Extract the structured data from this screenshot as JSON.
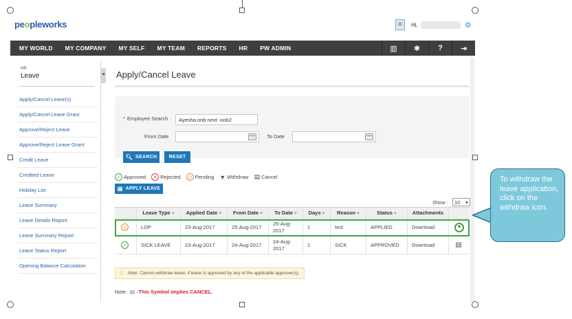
{
  "header": {
    "logo_primary": "pe",
    "logo_accent": "o",
    "logo_rest": "pleworks",
    "greeting": "Hi,"
  },
  "nav": {
    "items": [
      "MY WORLD",
      "MY COMPANY",
      "MY SELF",
      "MY TEAM",
      "REPORTS",
      "HR",
      "PW ADMIN"
    ],
    "icons": [
      "book-icon",
      "tools-icon",
      "help-icon",
      "exit-icon"
    ]
  },
  "sidebar": {
    "section": "HR",
    "title": "Leave",
    "items": [
      "Apply/Cancel Leave(s)",
      "Apply/Cancel Leave Grant",
      "Approve/Reject Leave",
      "Approve/Reject Leave Grant",
      "Credit Leave",
      "Credited Leave",
      "Holiday List",
      "Leave Summary",
      "Leave Details Report",
      "Leave Summary Report",
      "Leave Status Report",
      "Opening Balance Calculation"
    ]
  },
  "main": {
    "title": "Apply/Cancel Leave",
    "search": {
      "employee_label": "Employee Search",
      "employee_value": "Ayesha.onb next -onb2",
      "from_label": "From Date",
      "from_value": "",
      "to_label": "To Date",
      "to_value": "",
      "search_btn": "SEARCH",
      "reset_btn": "RESET"
    },
    "legend": {
      "approved": "Approved",
      "rejected": "Rejected",
      "pending": "Pending",
      "withdraw": "Withdraw",
      "cancel": "Cancel"
    },
    "apply_btn": "APPLY LEAVE",
    "show_label": "Show :",
    "show_value": "10",
    "table": {
      "columns": [
        "Leave Type",
        "Applied Date",
        "From Date",
        "To Date",
        "Days",
        "Reason",
        "Status",
        "Attachments"
      ],
      "rows": [
        {
          "status_icon": "pending",
          "leave_type": "LOP",
          "applied_date": "23-Aug-2017",
          "from_date": "25-Aug-2017",
          "to_date": "25-Aug-2017",
          "days": "1",
          "reason": "test",
          "status": "APPLIED",
          "attachments": "Download",
          "action": "withdraw"
        },
        {
          "status_icon": "approved",
          "leave_type": "SICK LEAVE",
          "applied_date": "23-Aug-2017",
          "from_date": "24-Aug-2017",
          "to_date": "24-Aug-2017",
          "days": "1",
          "reason": "SICK",
          "status": "APPROVED",
          "attachments": "Download",
          "action": "cancel"
        }
      ]
    },
    "note1": "Note: Cannot withdraw leave, if leave is approved by any of the applicable approver(s).",
    "note2_prefix": "Note:",
    "note2_text": "-This Symbol implies CANCEL."
  },
  "callout": {
    "text": "To withdraw the leave application, click on the withdraw icon."
  },
  "colors": {
    "nav_bg": "#3f3f3f",
    "primary_button": "#1f77b8",
    "link": "#2a64a8",
    "highlight": "#3fa33f",
    "callout_bg": "#7ec8dc"
  }
}
